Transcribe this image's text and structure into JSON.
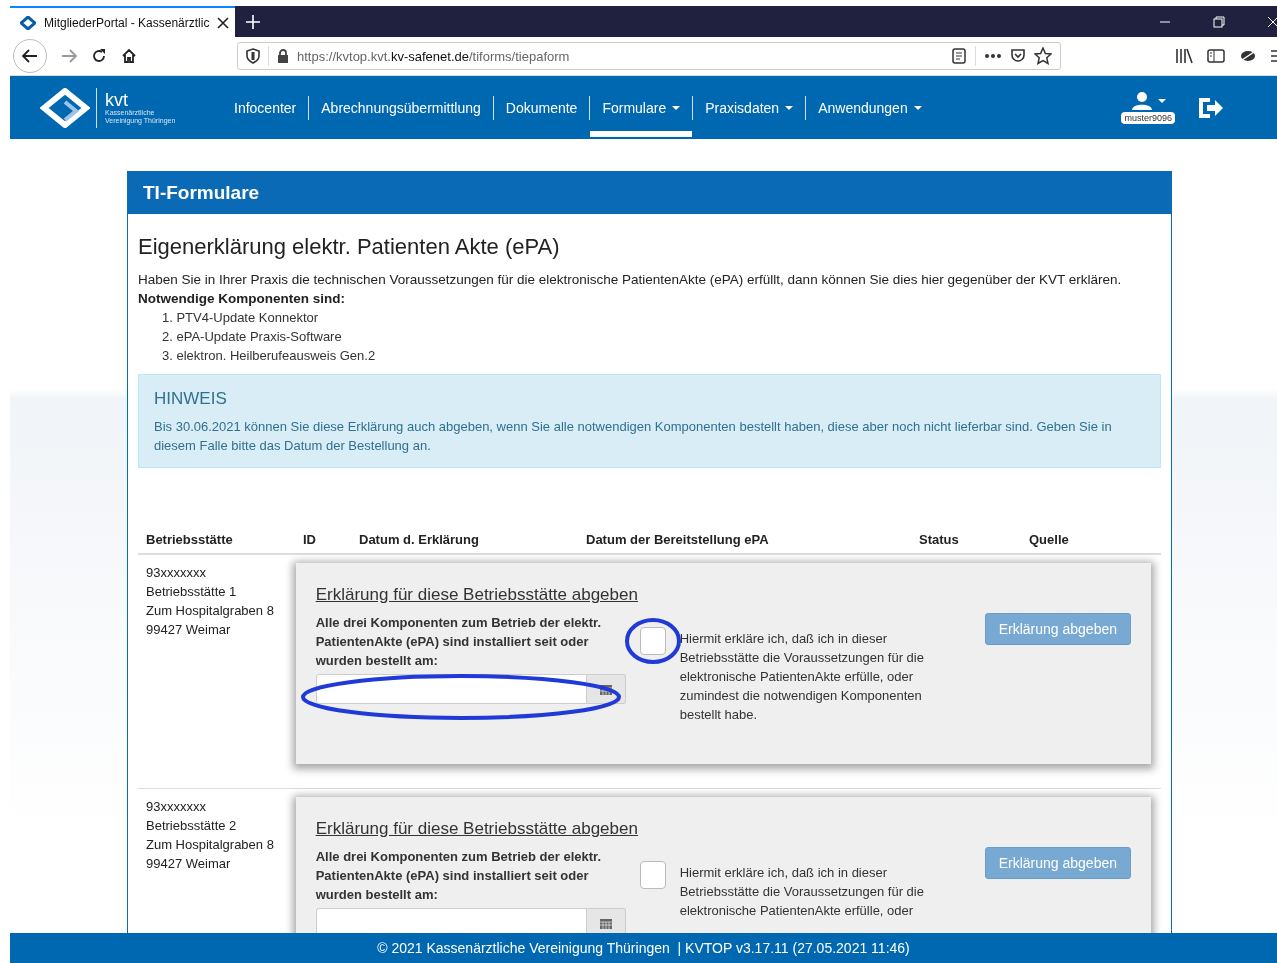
{
  "browser": {
    "tab_title": "MitgliederPortal - Kassenärztlic",
    "url_prefix": "https://kvtop.kvt.",
    "url_domain": "kv-safenet.de",
    "url_path": "/tiforms/tiepaform"
  },
  "header": {
    "logo_name": "kvt",
    "logo_line_1": "Kassenärztliche",
    "logo_line_2": "Vereinigung Thüringen",
    "username": "muster9096",
    "nav": [
      {
        "label": "Infocenter",
        "kind": "link",
        "selected": false
      },
      {
        "label": "Abrechnungsübermittlung",
        "kind": "link",
        "selected": false
      },
      {
        "label": "Dokumente",
        "kind": "link",
        "selected": false
      },
      {
        "label": "Formulare",
        "kind": "dropdown",
        "selected": true
      },
      {
        "label": "Praxisdaten",
        "kind": "dropdown",
        "selected": false
      },
      {
        "label": "Anwendungen",
        "kind": "dropdown",
        "selected": false
      }
    ]
  },
  "panel": {
    "title": "TI-Formulare",
    "heading": "Eigenerklärung elektr. Patienten Akte (ePA)",
    "intro": "Haben Sie in Ihrer Praxis die technischen Voraussetzungen für die elektronische PatientenAkte (ePA) erfüllt, dann können Sie dies hier gegenüber der KVT erklären. **Notwendige Komponenten sind:**",
    "components": [
      "1. PTV4-Update Konnektor",
      "2. ePA-Update Praxis-Software",
      "3. elektron. Heilberufeausweis Gen.2"
    ],
    "notice": {
      "title": "HINWEIS",
      "text": "Bis 30.06.2021 können Sie diese Erklärung auch abgeben, wenn Sie alle notwendigen Komponenten bestellt haben, diese aber noch nicht lieferbar sind. Geben Sie in diesem Falle bitte das Datum der Bestellung an."
    }
  },
  "table": {
    "columns": [
      "Betriebsstätte",
      "ID",
      "Datum d. Erklärung",
      "Datum der Bereitstellung ePA",
      "Status",
      "Quelle"
    ],
    "rows": [
      {
        "address": [
          "93xxxxxxx",
          "Betriebsstätte 1",
          "Zum Hospitalgraben 8",
          "99427 Weimar"
        ],
        "card_title": "Erklärung für diese Betriebsstätte abgeben",
        "date_label": "Alle drei Komponenten zum Betrieb der elektr. PatientenAkte (ePA) sind installiert seit oder wurden bestellt am:",
        "checked": false,
        "highlighted": true,
        "declaration": "Hiermit erkläre ich, daß ich in dieser Betriebsstätte die Voraussetzungen für die elektronische PatientenAkte erfülle, oder zumindest die notwendigen Komponenten bestellt habe.",
        "button": "Erklärung abgeben"
      },
      {
        "address": [
          "93xxxxxxx",
          "Betriebsstätte 2",
          "Zum Hospitalgraben 8",
          "99427 Weimar"
        ],
        "card_title": "Erklärung für diese Betriebsstätte abgeben",
        "date_label": "Alle drei Komponenten zum Betrieb der elektr. PatientenAkte (ePA) sind installiert seit oder wurden bestellt am:",
        "checked": false,
        "highlighted": false,
        "declaration": "Hiermit erkläre ich, daß ich in dieser Betriebsstätte die Voraussetzungen für die elektronische PatientenAkte erfülle, oder",
        "button": "Erklärung abgeben"
      }
    ]
  },
  "footer": "© 2021 Kassenärztliche Vereinigung Thüringen  | KVTOP v3.17.11 (27.05.2021 11:46)"
}
